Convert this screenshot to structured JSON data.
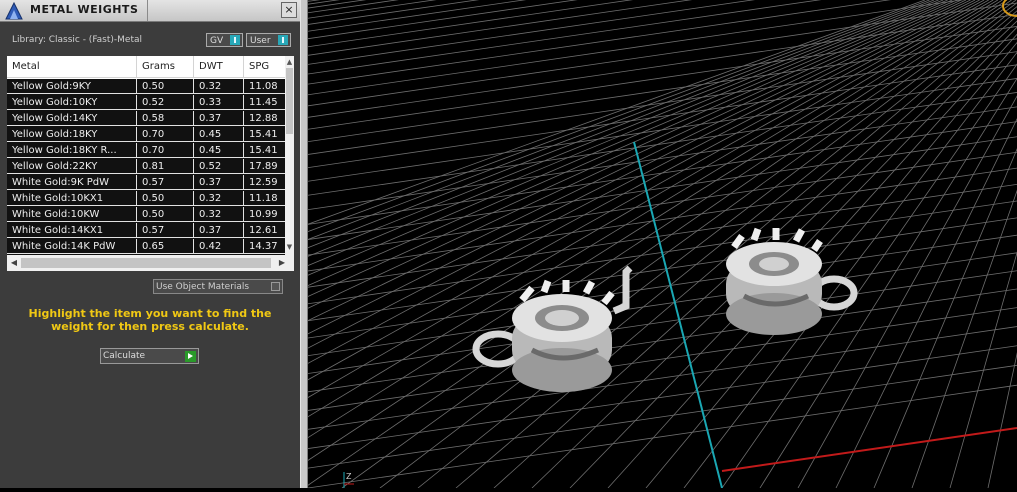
{
  "window": {
    "title": "METAL WEIGHTS",
    "close_label": "×"
  },
  "library_text": "Library: Classic - (Fast)-Metal",
  "toggles": {
    "gv": "GV",
    "user": "User"
  },
  "table": {
    "columns": [
      "Metal",
      "Grams",
      "DWT",
      "SPG"
    ],
    "rows": [
      [
        "Yellow Gold:9KY",
        "0.50",
        "0.32",
        "11.08"
      ],
      [
        "Yellow Gold:10KY",
        "0.52",
        "0.33",
        "11.45"
      ],
      [
        "Yellow Gold:14KY",
        "0.58",
        "0.37",
        "12.88"
      ],
      [
        "Yellow Gold:18KY",
        "0.70",
        "0.45",
        "15.41"
      ],
      [
        "Yellow Gold:18KY R...",
        "0.70",
        "0.45",
        "15.41"
      ],
      [
        "Yellow Gold:22KY",
        "0.81",
        "0.52",
        "17.89"
      ],
      [
        "White Gold:9K PdW",
        "0.57",
        "0.37",
        "12.59"
      ],
      [
        "White Gold:10KX1",
        "0.50",
        "0.32",
        "11.18"
      ],
      [
        "White Gold:10KW",
        "0.50",
        "0.32",
        "10.99"
      ],
      [
        "White Gold:14KX1",
        "0.57",
        "0.37",
        "12.61"
      ],
      [
        "White Gold:14K PdW",
        "0.65",
        "0.42",
        "14.37"
      ]
    ]
  },
  "use_object_materials": "Use Object Materials",
  "hint": "Highlight the item you want to find the weight for then press calculate.",
  "calculate_label": "Calculate",
  "colors": {
    "panel_bg": "#3c3c3c",
    "hint": "#f0c814",
    "toggle_accent": "#28a8b8",
    "grid": "#6e6e6e",
    "axis_cyan": "#1aa7b3",
    "axis_red": "#c21a1a",
    "model": "#d6d6d6"
  },
  "viewport": {
    "axis_gizmo_label": "Z"
  }
}
